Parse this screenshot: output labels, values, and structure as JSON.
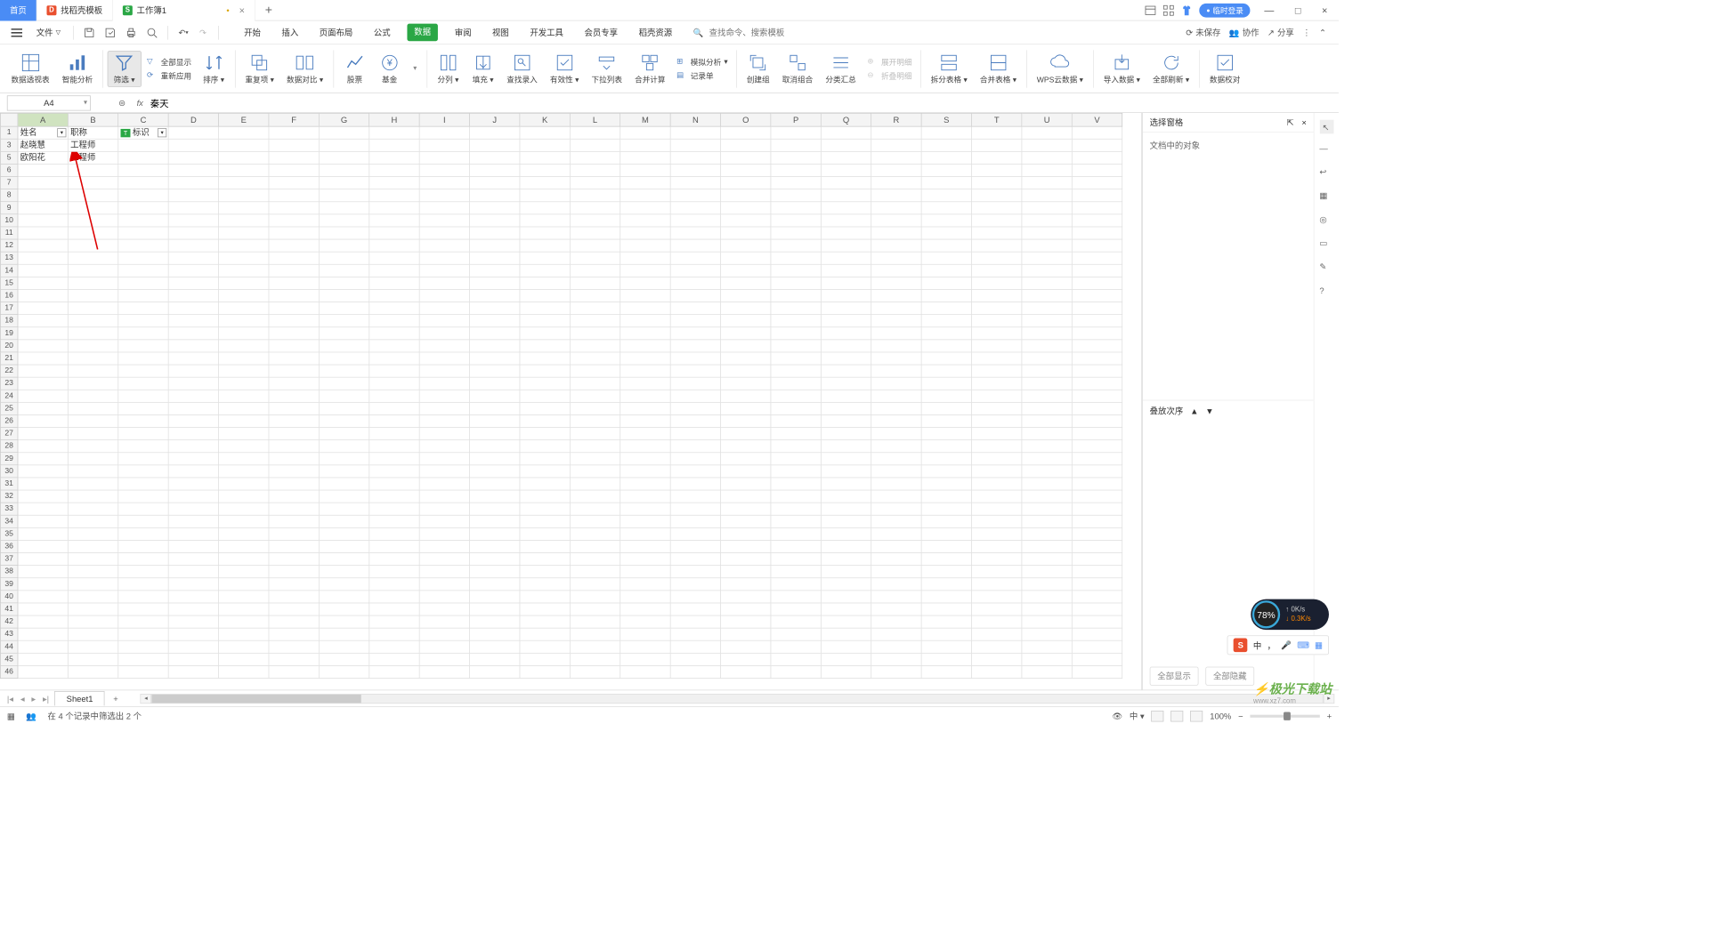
{
  "titlebar": {
    "home": "首页",
    "tab_template": "找稻壳模板",
    "tab_workbook": "工作簿1",
    "login": "临时登录"
  },
  "menubar": {
    "file": "文件",
    "tabs": [
      "开始",
      "插入",
      "页面布局",
      "公式",
      "数据",
      "审阅",
      "视图",
      "开发工具",
      "会员专享",
      "稻壳资源"
    ],
    "active_tab": "数据",
    "search_cmd_placeholder": "查找命令、搜索模板",
    "unsaved": "未保存",
    "coop": "协作",
    "share": "分享"
  },
  "ribbon": {
    "pivot": "数据透视表",
    "smart": "智能分析",
    "filter": "筛选",
    "show_all": "全部显示",
    "reapply": "重新应用",
    "sort": "排序",
    "dup": "重复项",
    "compare": "数据对比",
    "stock": "股票",
    "fund": "基金",
    "split": "分列",
    "fill": "填充",
    "lookup": "查找录入",
    "validity": "有效性",
    "dropdown": "下拉列表",
    "consolidate": "合并计算",
    "sim": "模拟分析",
    "form": "记录单",
    "group": "创建组",
    "ungroup": "取消组合",
    "subtotal": "分类汇总",
    "expand": "展开明细",
    "collapse": "折叠明细",
    "split_table": "拆分表格",
    "merge_table": "合并表格",
    "wps_cloud": "WPS云数据",
    "import": "导入数据",
    "refresh_all": "全部刷新",
    "data_check": "数据校对"
  },
  "formula": {
    "namebox": "A4",
    "value": "秦天"
  },
  "grid": {
    "cols": [
      "A",
      "B",
      "C",
      "D",
      "E",
      "F",
      "G",
      "H",
      "I",
      "J",
      "K",
      "L",
      "M",
      "N",
      "O",
      "P",
      "Q",
      "R",
      "S",
      "T",
      "U",
      "V"
    ],
    "visible_rows": [
      1,
      3,
      5,
      6,
      7,
      8,
      9,
      10,
      11,
      12,
      13,
      14,
      15,
      16,
      17,
      18,
      19,
      20,
      21,
      22,
      23,
      24,
      25,
      26,
      27,
      28,
      29,
      30,
      31,
      32,
      33,
      34,
      35,
      36,
      37,
      38,
      39,
      40,
      41,
      42,
      43,
      44,
      45,
      46
    ],
    "headers": {
      "a": "姓名",
      "b": "职称",
      "c": "标识"
    },
    "rows_data": [
      {
        "rn": 3,
        "a": "赵晓慧",
        "b": "工程师"
      },
      {
        "rn": 5,
        "a": "欧阳花",
        "b": "工程师"
      }
    ]
  },
  "side_panel": {
    "title": "选择窗格",
    "body": "文档中的对象",
    "order": "叠放次序",
    "show_all": "全部显示",
    "hide_all": "全部隐藏"
  },
  "sheet_tabs": {
    "sheet": "Sheet1"
  },
  "status": {
    "filter_msg": "在 4 个记录中筛选出 2 个",
    "zoom": "100%"
  },
  "perf": {
    "pct": "78%",
    "up": "0K/s",
    "down": "0.3K/s"
  },
  "ime": {
    "lang": "中"
  },
  "watermark": {
    "brand": "极光下载站",
    "url": "www.xz7.com"
  }
}
